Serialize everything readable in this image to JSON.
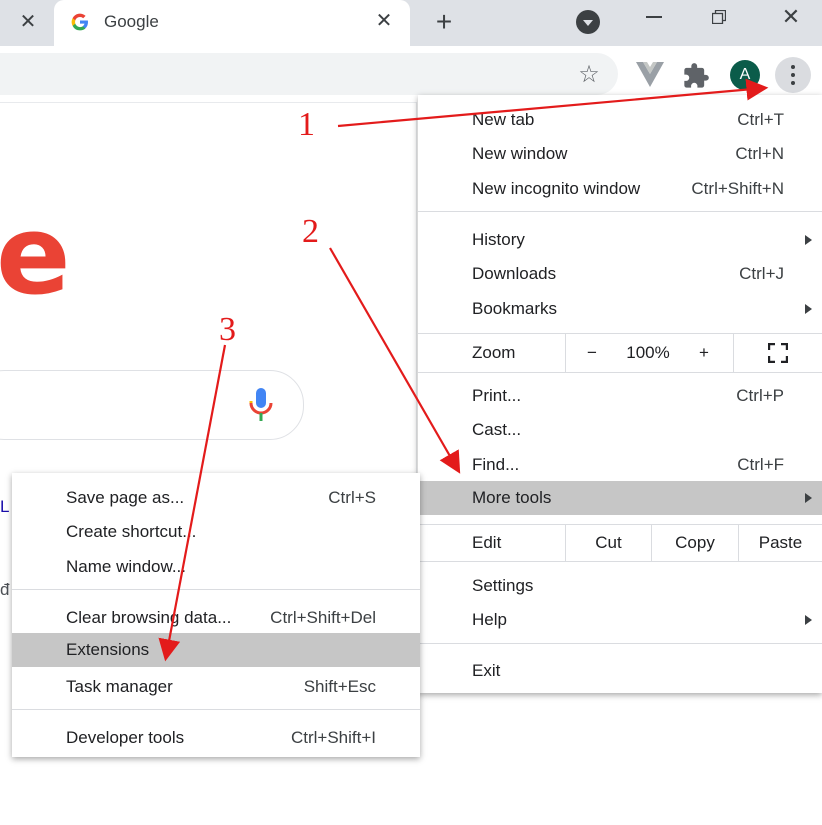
{
  "tab": {
    "title": "Google"
  },
  "profile": {
    "initial": "A"
  },
  "menu": {
    "items": [
      {
        "label": "New tab",
        "shortcut": "Ctrl+T"
      },
      {
        "label": "New window",
        "shortcut": "Ctrl+N"
      },
      {
        "label": "New incognito window",
        "shortcut": "Ctrl+Shift+N"
      },
      {
        "label": "History",
        "shortcut": ""
      },
      {
        "label": "Downloads",
        "shortcut": "Ctrl+J"
      },
      {
        "label": "Bookmarks",
        "shortcut": ""
      },
      {
        "label": "Print...",
        "shortcut": "Ctrl+P"
      },
      {
        "label": "Cast...",
        "shortcut": ""
      },
      {
        "label": "Find...",
        "shortcut": "Ctrl+F"
      },
      {
        "label": "More tools",
        "shortcut": ""
      },
      {
        "label": "Settings",
        "shortcut": ""
      },
      {
        "label": "Help",
        "shortcut": ""
      },
      {
        "label": "Exit",
        "shortcut": ""
      }
    ],
    "zoom": {
      "label": "Zoom",
      "minus": "−",
      "value": "100%",
      "plus": "+"
    },
    "edit": {
      "label": "Edit",
      "cut": "Cut",
      "copy": "Copy",
      "paste": "Paste"
    }
  },
  "submenu": {
    "items": [
      {
        "label": "Save page as...",
        "shortcut": "Ctrl+S"
      },
      {
        "label": "Create shortcut...",
        "shortcut": ""
      },
      {
        "label": "Name window...",
        "shortcut": ""
      },
      {
        "label": "Clear browsing data...",
        "shortcut": "Ctrl+Shift+Del"
      },
      {
        "label": "Extensions",
        "shortcut": ""
      },
      {
        "label": "Task manager",
        "shortcut": "Shift+Esc"
      },
      {
        "label": "Developer tools",
        "shortcut": "Ctrl+Shift+I"
      }
    ]
  },
  "page": {
    "logo_fragment": "e",
    "link_fragment": "L",
    "text_fragment": "đ"
  },
  "annotations": {
    "step1": "1",
    "step2": "2",
    "step3": "3"
  },
  "colors": {
    "annotation": "#e31b1b",
    "highlight": "#c6c6c6",
    "tabstrip": "#dee1e6",
    "avatar": "#0b5c4a"
  },
  "icons": [
    "close-icon",
    "google-icon",
    "plus-icon",
    "tab-search-icon",
    "minimize-icon",
    "restore-icon",
    "star-icon",
    "vue-devtools-icon",
    "extensions-puzzle-icon",
    "kebab-menu-icon",
    "fullscreen-icon",
    "microphone-icon",
    "submenu-arrow-icon"
  ]
}
